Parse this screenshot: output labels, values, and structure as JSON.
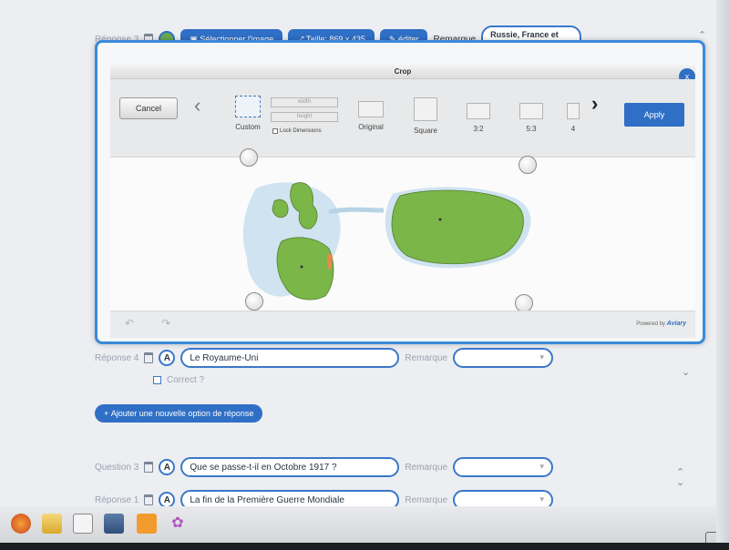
{
  "top_row": {
    "label": "Réponse 3",
    "select_image": "Sélectionner l'image",
    "size": "Taille: 869 x 435",
    "edit": "éditer",
    "remark_label": "Remarque",
    "remark_value": "Russie, France et Royaume Uni"
  },
  "crop_modal": {
    "title": "Crop",
    "close": "x",
    "cancel": "Cancel",
    "width_placeholder": "width",
    "height_placeholder": "height",
    "lock_dimensions": "Lock Dimensions",
    "presets": [
      "Custom",
      "Original",
      "Square",
      "3:2",
      "5:3",
      "4"
    ],
    "apply": "Apply",
    "powered_by": "Powered by",
    "brand": "Aviary"
  },
  "rows": {
    "reponse4": {
      "label": "Réponse 4",
      "value": "Le Royaume-Uni",
      "remark_label": "Remarque",
      "correct_label": "Correct ?"
    },
    "add_option": "Ajouter une nouvelle option de réponse",
    "question3": {
      "label": "Question 3",
      "value": "Que se passe-t-il en Octobre 1917 ?",
      "remark_label": "Remarque"
    },
    "reponse1": {
      "label": "Réponse 1",
      "value": "La fin de la Première Guerre Mondiale",
      "remark_label": "Remarque"
    }
  },
  "icons": {
    "trash": "trash-icon",
    "letter_a": "A",
    "plus": "+"
  },
  "colors": {
    "accent": "#2f6fc6",
    "land": "#7ab648",
    "water": "#cfe3f0"
  }
}
